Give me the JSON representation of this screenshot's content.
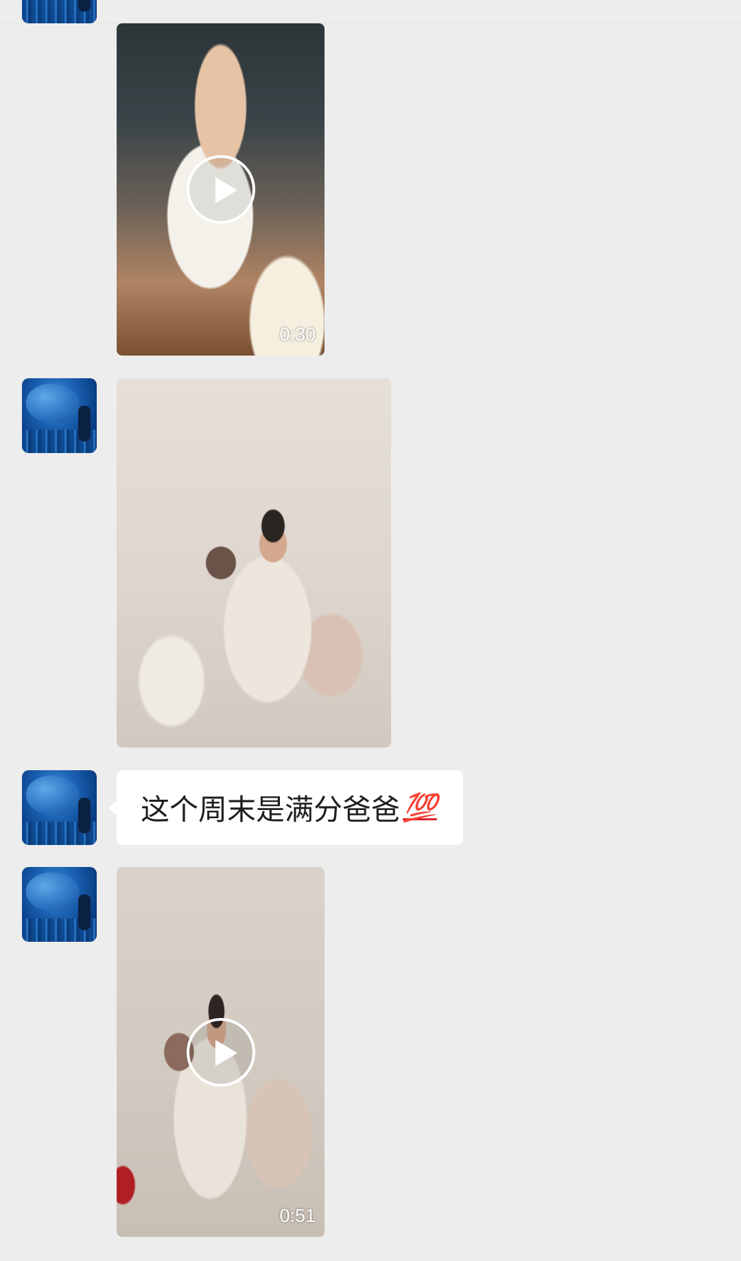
{
  "messages": [
    {
      "type": "video",
      "duration": "0:30",
      "description_icon": "play-icon"
    },
    {
      "type": "image"
    },
    {
      "type": "text",
      "text": "这个周末是满分爸爸",
      "emoji": "💯"
    },
    {
      "type": "video",
      "duration": "0:51",
      "description_icon": "play-icon"
    }
  ],
  "colors": {
    "background": "#ededed",
    "bubble": "#ffffff",
    "text": "#1e1e1e"
  }
}
